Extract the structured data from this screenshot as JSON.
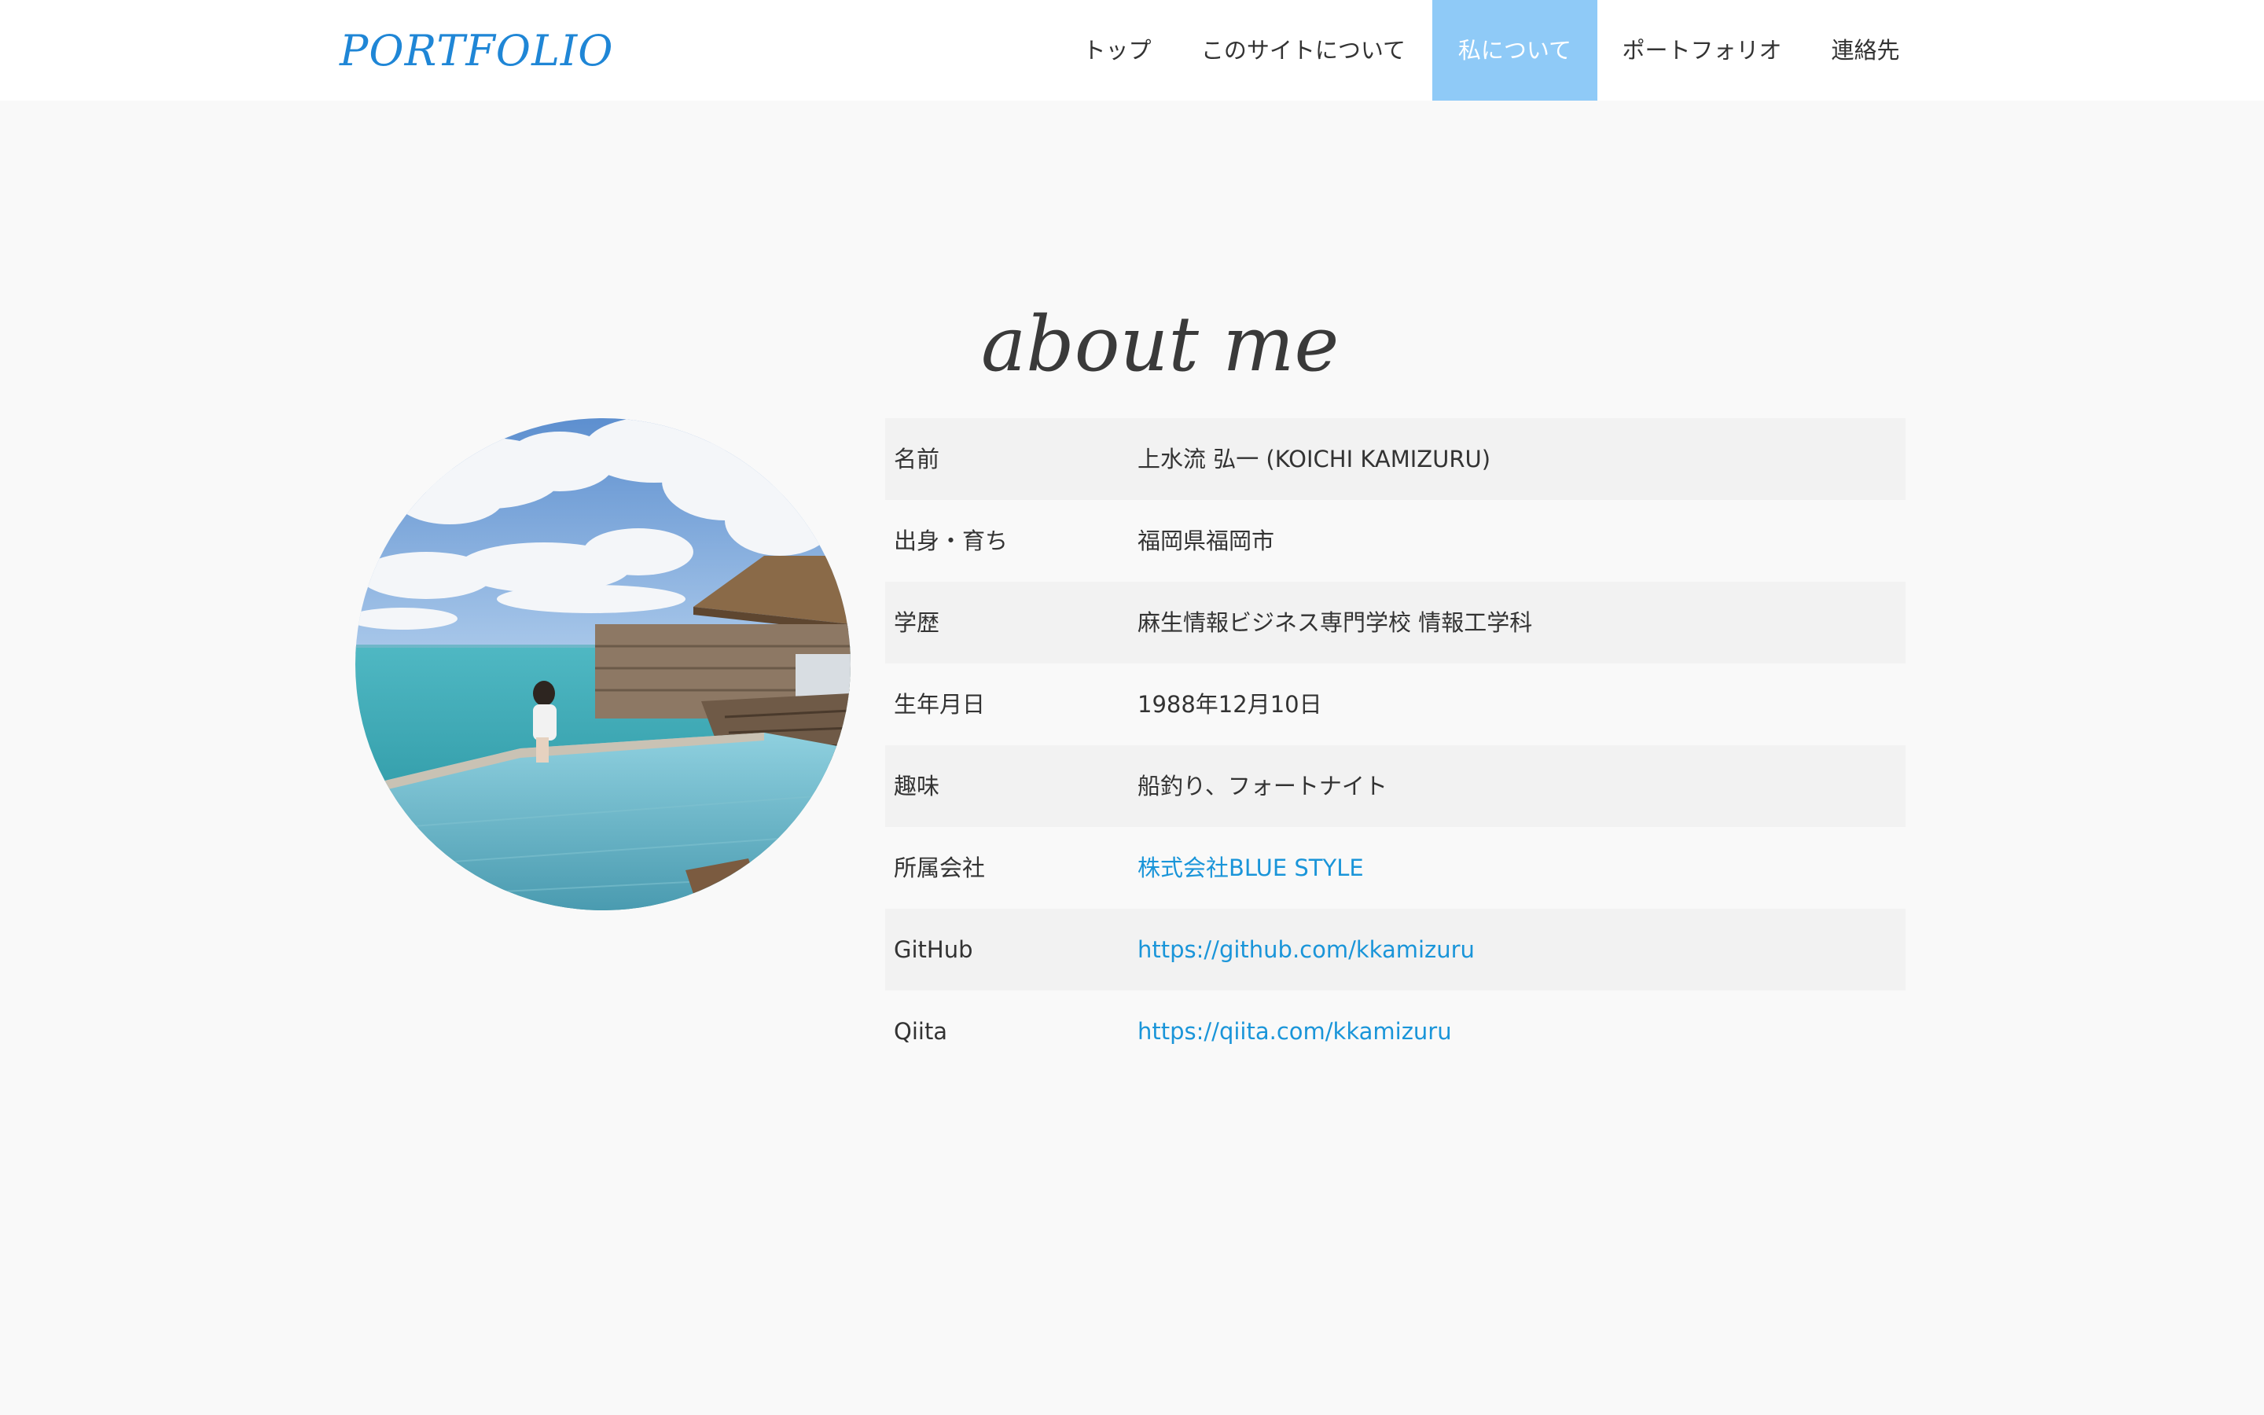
{
  "header": {
    "logo": "PORTFOLIO",
    "nav": [
      {
        "label": "トップ",
        "active": false
      },
      {
        "label": "このサイトについて",
        "active": false
      },
      {
        "label": "私について",
        "active": true
      },
      {
        "label": "ポートフォリオ",
        "active": false
      },
      {
        "label": "連絡先",
        "active": false
      }
    ]
  },
  "about": {
    "title": "about me",
    "rows": [
      {
        "label": "名前",
        "value": "上水流 弘一 (KOICHI KAMIZURU)",
        "link": false
      },
      {
        "label": "出身・育ち",
        "value": "福岡県福岡市",
        "link": false
      },
      {
        "label": "学歴",
        "value": "麻生情報ビジネス専門学校 情報工学科",
        "link": false
      },
      {
        "label": "生年月日",
        "value": "1988年12月10日",
        "link": false
      },
      {
        "label": "趣味",
        "value": "船釣り、フォートナイト",
        "link": false
      },
      {
        "label": "所属会社",
        "value": "株式会社BLUE STYLE",
        "link": true
      },
      {
        "label": "GitHub",
        "value": "https://github.com/kkamizuru",
        "link": true
      },
      {
        "label": "Qiita",
        "value": "https://qiita.com/kkamizuru",
        "link": true
      }
    ]
  },
  "colors": {
    "accent": "#1f86d6",
    "nav_active_bg": "#8fcaf7",
    "link": "#1a95d9",
    "page_bg": "#f9f9f9",
    "row_shade": "#f2f2f2"
  }
}
